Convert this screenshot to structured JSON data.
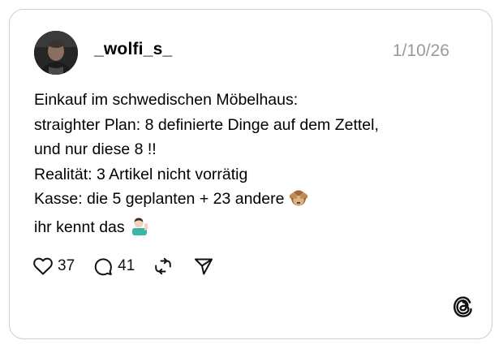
{
  "post": {
    "username": "_wolfi_s_",
    "date": "1/10/26",
    "lines": [
      "Einkauf im schwedischen Möbelhaus:",
      "straighter Plan:  8 definierte Dinge auf dem Zettel,",
      "und nur diese 8 !!",
      "Realität: 3 Artikel nicht vorrätig",
      "Kasse: die 5 geplanten + 23 andere",
      "ihr kennt das"
    ],
    "emojis": [
      "see-no-evil-monkey",
      "person-tipping-hand"
    ],
    "likes": "37",
    "replies": "41"
  },
  "icons": {
    "like": "heart-icon",
    "reply": "speech-bubble-icon",
    "repost": "repost-icon",
    "share": "send-icon",
    "brand": "threads-logo"
  }
}
